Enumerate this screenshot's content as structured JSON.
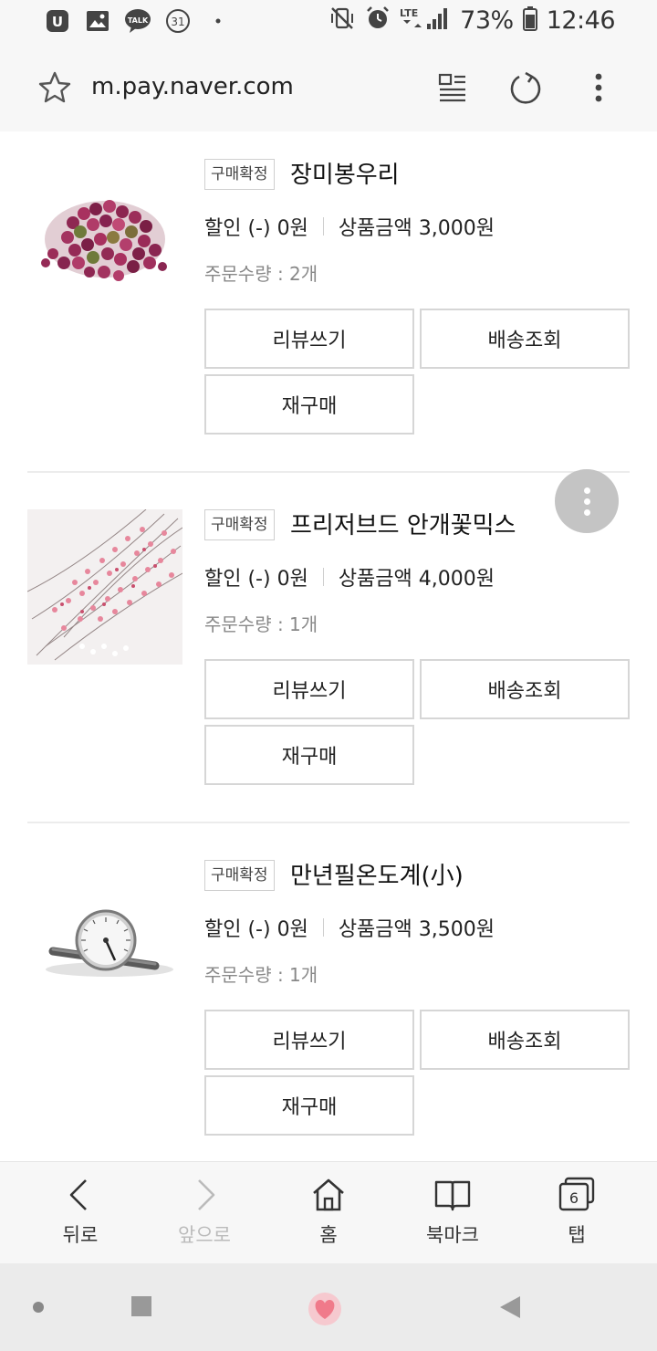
{
  "status_bar": {
    "battery": "73%",
    "time": "12:46",
    "calendar_day": "31",
    "network": "LTE",
    "talk_label": "TALK"
  },
  "url_bar": {
    "url": "m.pay.naver.com"
  },
  "orders": [
    {
      "badge": "구매확정",
      "title": "장미봉우리",
      "discount": "할인 (-) 0원",
      "amount": "상품금액 3,000원",
      "quantity": "주문수량 : 2개",
      "image_icon": "rose-buds-image"
    },
    {
      "badge": "구매확정",
      "title": "프리저브드 안개꽃믹스",
      "discount": "할인 (-) 0원",
      "amount": "상품금액 4,000원",
      "quantity": "주문수량 : 1개",
      "image_icon": "babys-breath-image"
    },
    {
      "badge": "구매확정",
      "title": "만년필온도계(小)",
      "discount": "할인 (-) 0원",
      "amount": "상품금액 3,500원",
      "quantity": "주문수량 : 1개",
      "image_icon": "thermometer-image"
    }
  ],
  "buttons": {
    "review": "리뷰쓰기",
    "shipping": "배송조회",
    "rebuy": "재구매"
  },
  "bottom_nav": {
    "back": "뒤로",
    "forward": "앞으로",
    "home": "홈",
    "bookmark": "북마크",
    "tabs": "탭",
    "tab_count": "6"
  },
  "colors": {
    "bar_bg": "#f7f7f7",
    "border": "#d6d6d6",
    "muted_text": "#888888",
    "heart": "#f07a8a"
  }
}
